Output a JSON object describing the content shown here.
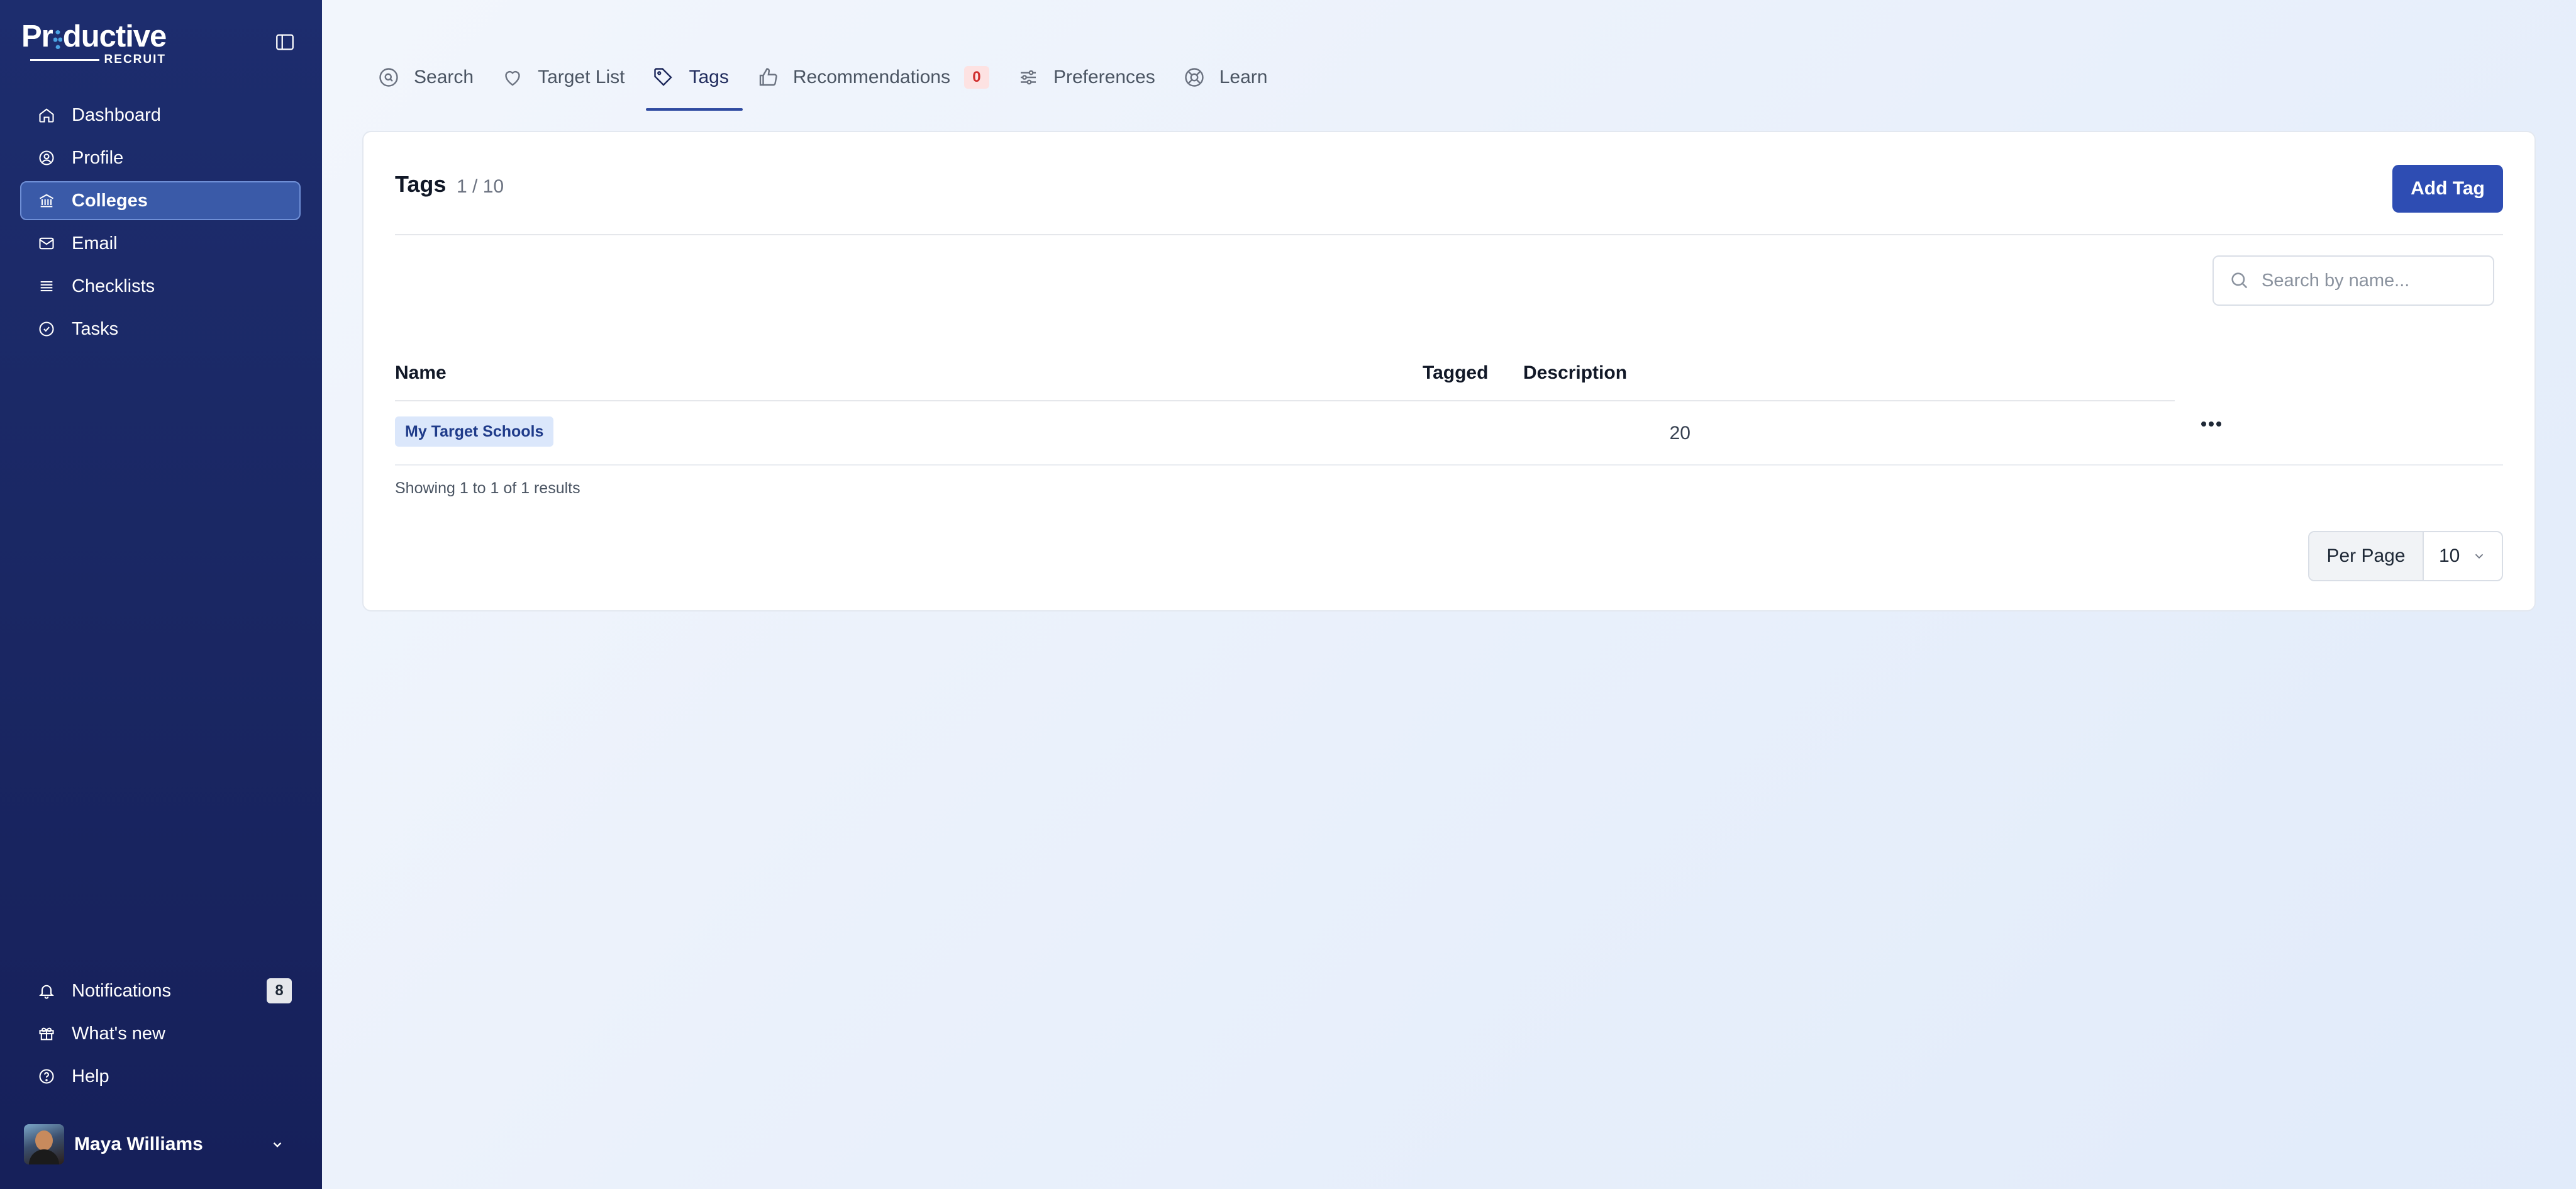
{
  "brand": {
    "word_pre": "Pr",
    "word_post": "ductive",
    "sub": "RECRUIT"
  },
  "sidebar": {
    "items": [
      {
        "label": "Dashboard",
        "icon": "home-icon"
      },
      {
        "label": "Profile",
        "icon": "user-circle-icon"
      },
      {
        "label": "Colleges",
        "icon": "building-icon",
        "active": true
      },
      {
        "label": "Email",
        "icon": "mail-icon"
      },
      {
        "label": "Checklists",
        "icon": "list-icon"
      },
      {
        "label": "Tasks",
        "icon": "check-circle-icon"
      }
    ],
    "bottom": [
      {
        "label": "Notifications",
        "icon": "bell-icon",
        "count": "8"
      },
      {
        "label": "What's new",
        "icon": "gift-icon"
      },
      {
        "label": "Help",
        "icon": "help-circle-icon"
      }
    ],
    "user": {
      "name": "Maya Williams"
    }
  },
  "tabs": [
    {
      "label": "Search",
      "icon": "search-circle-icon"
    },
    {
      "label": "Target List",
      "icon": "heart-icon"
    },
    {
      "label": "Tags",
      "icon": "tag-icon",
      "active": true
    },
    {
      "label": "Recommendations",
      "icon": "thumbs-up-icon",
      "badge": "0"
    },
    {
      "label": "Preferences",
      "icon": "sliders-icon"
    },
    {
      "label": "Learn",
      "icon": "lifebuoy-icon"
    }
  ],
  "tags_card": {
    "title": "Tags",
    "count": "1 / 10",
    "add_button": "Add Tag",
    "search_placeholder": "Search by name...",
    "columns": {
      "name": "Name",
      "tagged": "Tagged",
      "description": "Description"
    },
    "rows": [
      {
        "name": "My Target Schools",
        "tagged": "20",
        "description": ""
      }
    ],
    "showing": "Showing 1 to 1 of 1 results",
    "per_page_label": "Per Page",
    "per_page_value": "10"
  },
  "colors": {
    "sidebar": "#1a2763",
    "accent": "#2e4db3",
    "active_nav": "#3a5aa8",
    "badge_red": "#d03030"
  }
}
